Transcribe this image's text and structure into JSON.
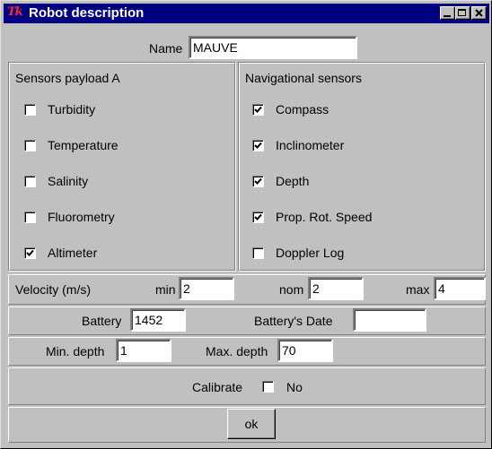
{
  "window": {
    "logo": "Tk",
    "title": "Robot description"
  },
  "name": {
    "label": "Name",
    "value": "MAUVE"
  },
  "sensors_a": {
    "title": "Sensors payload A",
    "items": [
      {
        "label": "Turbidity",
        "checked": false
      },
      {
        "label": "Temperature",
        "checked": false
      },
      {
        "label": "Salinity",
        "checked": false
      },
      {
        "label": "Fluorometry",
        "checked": false
      },
      {
        "label": "Altimeter",
        "checked": true
      }
    ]
  },
  "nav_sensors": {
    "title": "Navigational sensors",
    "items": [
      {
        "label": "Compass",
        "checked": true
      },
      {
        "label": "Inclinometer",
        "checked": true
      },
      {
        "label": "Depth",
        "checked": true
      },
      {
        "label": "Prop. Rot. Speed",
        "checked": true
      },
      {
        "label": "Doppler Log",
        "checked": false
      }
    ]
  },
  "velocity": {
    "label": "Velocity (m/s)",
    "min_label": "min",
    "min": "2",
    "nom_label": "nom",
    "nom": "2",
    "max_label": "max",
    "max": "4"
  },
  "battery": {
    "label": "Battery",
    "value": "1452",
    "date_label": "Battery's Date",
    "date": ""
  },
  "depth": {
    "min_label": "Min. depth",
    "min": "1",
    "max_label": "Max. depth",
    "max": "70"
  },
  "calibrate": {
    "label": "Calibrate",
    "option": "No",
    "checked": false
  },
  "ok_label": "ok"
}
